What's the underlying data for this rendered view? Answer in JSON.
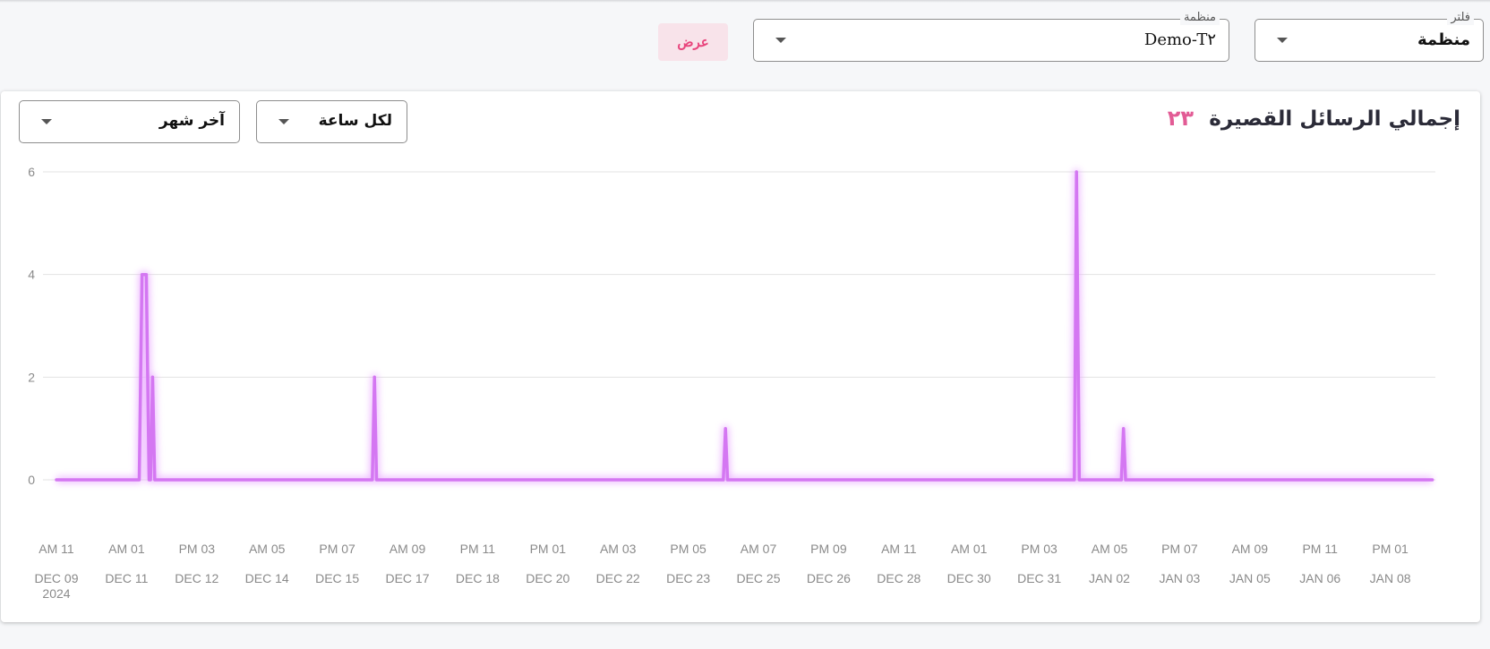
{
  "filters": {
    "filter_label": "فلتر",
    "filter_value": "منظمة",
    "org_label": "منظمة",
    "org_value": "Demo-T٢",
    "view_button": "عرض"
  },
  "card": {
    "title": "إجمالي الرسائل القصيرة",
    "count": "٢٣",
    "granularity": "لكل ساعة",
    "range": "آخر شهر"
  },
  "colors": {
    "line": "#d477f2",
    "glow": "#e9a9ff",
    "accent": "#e25b95",
    "button_bg": "#f8e3ea"
  },
  "chart_data": {
    "type": "line",
    "title": "",
    "xlabel": "",
    "ylabel": "",
    "ylim": [
      0,
      6
    ],
    "yticks": [
      "0",
      "2",
      "4",
      "6"
    ],
    "grid": true,
    "x_ticks": [
      {
        "time": "AM 11",
        "date": "DEC 09",
        "year": "2024"
      },
      {
        "time": "AM 01",
        "date": "DEC 11"
      },
      {
        "time": "PM 03",
        "date": "DEC 12"
      },
      {
        "time": "AM 05",
        "date": "DEC 14"
      },
      {
        "time": "PM 07",
        "date": "DEC 15"
      },
      {
        "time": "AM 09",
        "date": "DEC 17"
      },
      {
        "time": "PM 11",
        "date": "DEC 18"
      },
      {
        "time": "PM 01",
        "date": "DEC 20"
      },
      {
        "time": "AM 03",
        "date": "DEC 22"
      },
      {
        "time": "PM 05",
        "date": "DEC 23"
      },
      {
        "time": "AM 07",
        "date": "DEC 25"
      },
      {
        "time": "PM 09",
        "date": "DEC 26"
      },
      {
        "time": "AM 11",
        "date": "DEC 28"
      },
      {
        "time": "AM 01",
        "date": "DEC 30"
      },
      {
        "time": "PM 03",
        "date": "DEC 31"
      },
      {
        "time": "AM 05",
        "date": "JAN 02"
      },
      {
        "time": "PM 07",
        "date": "JAN 03"
      },
      {
        "time": "AM 09",
        "date": "JAN 05"
      },
      {
        "time": "PM 11",
        "date": "JAN 06"
      },
      {
        "time": "PM 01",
        "date": "JAN 08"
      }
    ],
    "series": [
      {
        "points": [
          {
            "x": 0,
            "y": 0
          },
          {
            "x": 1.18,
            "y": 0
          },
          {
            "x": 1.22,
            "y": 4
          },
          {
            "x": 1.28,
            "y": 4
          },
          {
            "x": 1.32,
            "y": 0
          },
          {
            "x": 1.34,
            "y": 0
          },
          {
            "x": 1.37,
            "y": 2
          },
          {
            "x": 1.4,
            "y": 0
          },
          {
            "x": 4.5,
            "y": 0
          },
          {
            "x": 4.53,
            "y": 2
          },
          {
            "x": 4.56,
            "y": 0
          },
          {
            "x": 9.5,
            "y": 0
          },
          {
            "x": 9.53,
            "y": 1
          },
          {
            "x": 9.56,
            "y": 0
          },
          {
            "x": 14.5,
            "y": 0
          },
          {
            "x": 14.53,
            "y": 6
          },
          {
            "x": 14.57,
            "y": 0
          },
          {
            "x": 15.17,
            "y": 0
          },
          {
            "x": 15.2,
            "y": 1
          },
          {
            "x": 15.23,
            "y": 0
          },
          {
            "x": 19.6,
            "y": 0
          }
        ]
      }
    ]
  }
}
